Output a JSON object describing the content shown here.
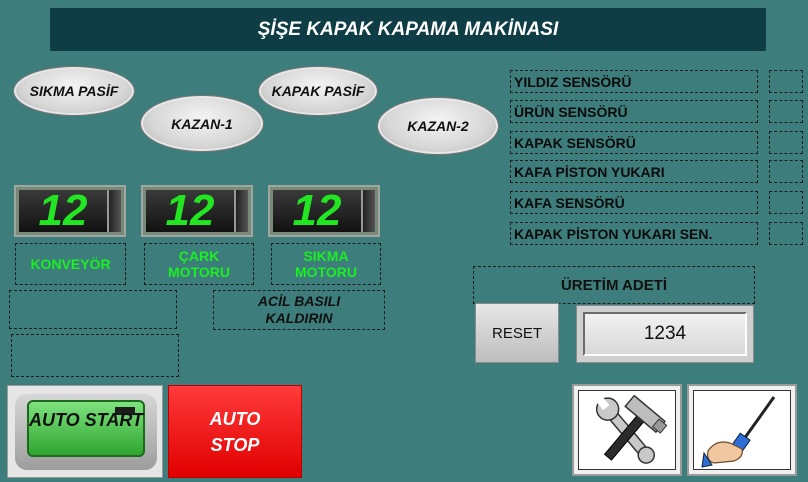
{
  "title": "ŞİŞE KAPAK KAPAMA MAKİNASI",
  "status_indicators": [
    {
      "label": "SIKMA PASİF"
    },
    {
      "label": "KAZAN-1"
    },
    {
      "label": "KAPAK PASİF"
    },
    {
      "label": "KAZAN-2"
    }
  ],
  "motors": [
    {
      "value": "12",
      "label": "KONVEYÖR"
    },
    {
      "value": "12",
      "label": "ÇARK MOTORU"
    },
    {
      "value": "12",
      "label": "SIKMA MOTORU"
    }
  ],
  "emergency_message": "ACİL BASILI KALDIRIN",
  "sensors": [
    {
      "label": "YILDIZ SENSÖRÜ"
    },
    {
      "label": "ÜRÜN SENSÖRÜ"
    },
    {
      "label": "KAPAK SENSÖRÜ"
    },
    {
      "label": "KAFA PİSTON YUKARI"
    },
    {
      "label": "KAFA SENSÖRÜ"
    },
    {
      "label": "KAPAK PİSTON YUKARI SEN."
    }
  ],
  "production": {
    "label": "ÜRETİM ADETİ",
    "count": "1234",
    "reset_label": "RESET"
  },
  "controls": {
    "auto_start_label": "AUTO START",
    "auto_stop_label": "AUTO STOP"
  },
  "icons": {
    "settings": "tools-icon",
    "manual": "screwdriver-hand-icon"
  },
  "colors": {
    "background": "#3d7d7b",
    "title_bar": "#0f3d45",
    "display_digits": "#22e622",
    "motor_label": "#1bee23",
    "stop_button": "#ff2a2a"
  }
}
